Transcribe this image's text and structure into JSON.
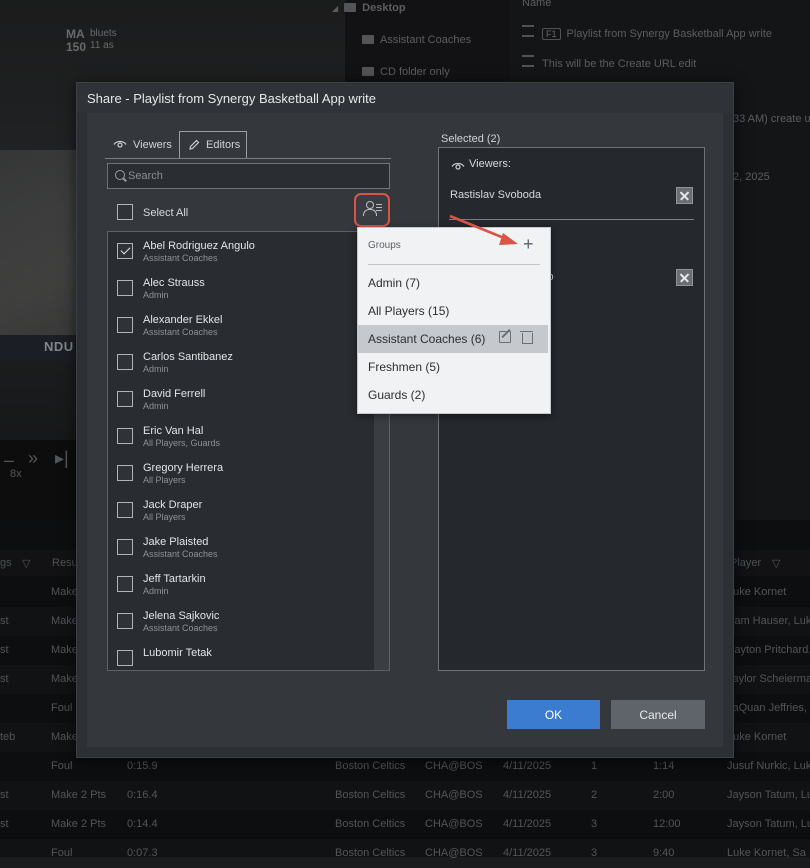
{
  "background": {
    "video_banner": "NDU",
    "video_overlay_text": [
      "bluets",
      "11 as",
      "MA",
      "150"
    ],
    "speed": "8x",
    "folder_tree": [
      {
        "label": "Desktop",
        "expanded": true
      },
      {
        "label": "Assistant Coaches"
      },
      {
        "label": "CD folder only"
      }
    ],
    "playlist_panel": {
      "header": "Name",
      "rows": [
        {
          "badge": "F1",
          "label": "Playlist from Synergy Basketball App write"
        },
        {
          "label": "This will be the Create URL edit"
        }
      ],
      "detail_lines": [
        "33 AM) create u",
        "2, 2025"
      ]
    },
    "table": {
      "headers": [
        "gs",
        "Resu",
        "Player"
      ],
      "rows": [
        {
          "c1": "",
          "c2": "Make",
          "player": "Luke Kornet"
        },
        {
          "c1": "st",
          "c2": "Make",
          "player": "Sam Hauser, Luk"
        },
        {
          "c1": "st",
          "c2": "Make",
          "player": "Payton Pritchard,"
        },
        {
          "c1": "st",
          "c2": "Make",
          "player": "Taylor Scheierma"
        },
        {
          "c1": "",
          "c2": "Foul",
          "player": "JaQuan Jeffries,"
        },
        {
          "c1": "teb",
          "c2": "Make",
          "player": "Luke Kornet"
        },
        {
          "c1": "",
          "c2": "Foul",
          "time": "0:15.9",
          "team": "Boston Celtics",
          "game": "CHA@BOS",
          "date": "4/11/2025",
          "period": "1",
          "clock": "1:14",
          "player": "Jusuf Nurkic, Luk"
        },
        {
          "c1": "st",
          "c2": "Make 2 Pts",
          "time": "0:16.4",
          "team": "Boston Celtics",
          "game": "CHA@BOS",
          "date": "4/11/2025",
          "period": "2",
          "clock": "2:00",
          "player": "Jayson Tatum, Lu"
        },
        {
          "c1": "st",
          "c2": "Make 2 Pts",
          "time": "0:14.4",
          "team": "Boston Celtics",
          "game": "CHA@BOS",
          "date": "4/11/2025",
          "period": "3",
          "clock": "12:00",
          "player": "Jayson Tatum, Lu"
        },
        {
          "c1": "",
          "c2": "Foul",
          "time": "0:07.3",
          "team": "Boston Celtics",
          "game": "CHA@BOS",
          "date": "4/11/2025",
          "period": "3",
          "clock": "9:40",
          "player": "Luke Kornet, Sa"
        }
      ]
    }
  },
  "dialog": {
    "title": "Share - Playlist from Synergy Basketball App write",
    "tabs": [
      {
        "label": "Viewers",
        "icon": "eye-icon",
        "active": false
      },
      {
        "label": "Editors",
        "icon": "pencil-icon",
        "active": true
      }
    ],
    "search": {
      "placeholder": "Search",
      "value": ""
    },
    "select_all_label": "Select All",
    "users": [
      {
        "name": "Abel Rodriguez Angulo",
        "group": "Assistant Coaches",
        "checked": true
      },
      {
        "name": "Alec Strauss",
        "group": "Admin",
        "checked": false
      },
      {
        "name": "Alexander Ekkel",
        "group": "Assistant Coaches",
        "checked": false
      },
      {
        "name": "Carlos Santibanez",
        "group": "Admin",
        "checked": false
      },
      {
        "name": "David Ferrell",
        "group": "Admin",
        "checked": false
      },
      {
        "name": "Eric Van Hal",
        "group": "All Players, Guards",
        "checked": false
      },
      {
        "name": "Gregory Herrera",
        "group": "All Players",
        "checked": false
      },
      {
        "name": "Jack Draper",
        "group": "All Players",
        "checked": false
      },
      {
        "name": "Jake Plaisted",
        "group": "Assistant Coaches",
        "checked": false
      },
      {
        "name": "Jeff Tartarkin",
        "group": "Admin",
        "checked": false
      },
      {
        "name": "Jelena Sajkovic",
        "group": "Assistant Coaches",
        "checked": false
      },
      {
        "name": "Lubomir Tetak",
        "group": "",
        "checked": false
      }
    ],
    "selected": {
      "label": "Selected (2)",
      "viewers_label": "Viewers:",
      "viewers": [
        "Rastislav Svoboda"
      ],
      "editors_partial": "ulo"
    },
    "ok_label": "OK",
    "cancel_label": "Cancel"
  },
  "groups_popup": {
    "title": "Groups",
    "add_label": "+",
    "items": [
      {
        "label": "Admin (7)",
        "highlighted": false
      },
      {
        "label": "All Players (15)",
        "highlighted": false
      },
      {
        "label": "Assistant Coaches (6)",
        "highlighted": true
      },
      {
        "label": "Freshmen (5)",
        "highlighted": false
      },
      {
        "label": "Guards (2)",
        "highlighted": false
      }
    ]
  },
  "colors": {
    "annotation": "#d95446",
    "ok_button": "#3b7bd0",
    "cancel_button": "#5f646b"
  }
}
